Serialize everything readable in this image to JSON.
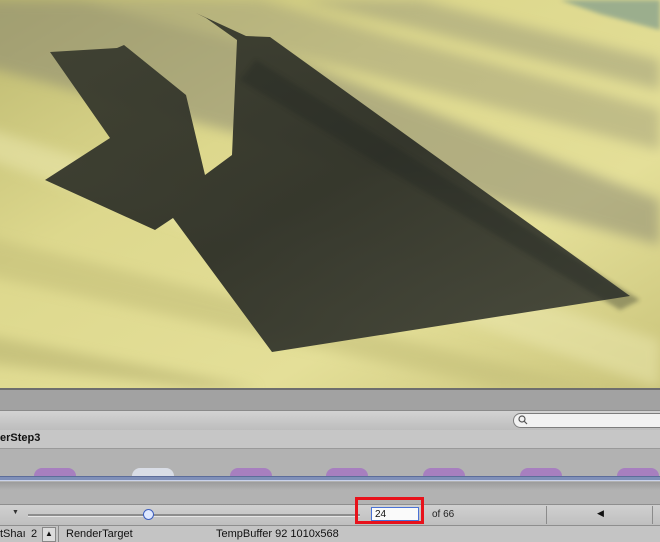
{
  "panel": {
    "step_title": "erStep3"
  },
  "scrubber": {
    "slider_value": 24,
    "slider_max": 66,
    "event_value": "24",
    "of_label": "of 66",
    "prev_icon": "triangle-left-icon",
    "dropdown_icon": "chevron-down-icon"
  },
  "properties": {
    "shader_cell": "tShaı",
    "count_value": "2",
    "render_target_label": "RenderTarget",
    "buffer_info": "TempBuffer 92 1010x568"
  },
  "colors": {
    "highlight": "#e8121b",
    "track_line": "#7f8fb8",
    "marker_purple": "#a77fbf",
    "marker_selected": "#d9dde6",
    "shadow": "#3f4133",
    "ground": "#d9d487"
  },
  "markers": [
    {
      "state": "normal"
    },
    {
      "state": "selected"
    },
    {
      "state": "normal"
    },
    {
      "state": "normal"
    },
    {
      "state": "normal"
    },
    {
      "state": "normal"
    },
    {
      "state": "normal"
    }
  ]
}
